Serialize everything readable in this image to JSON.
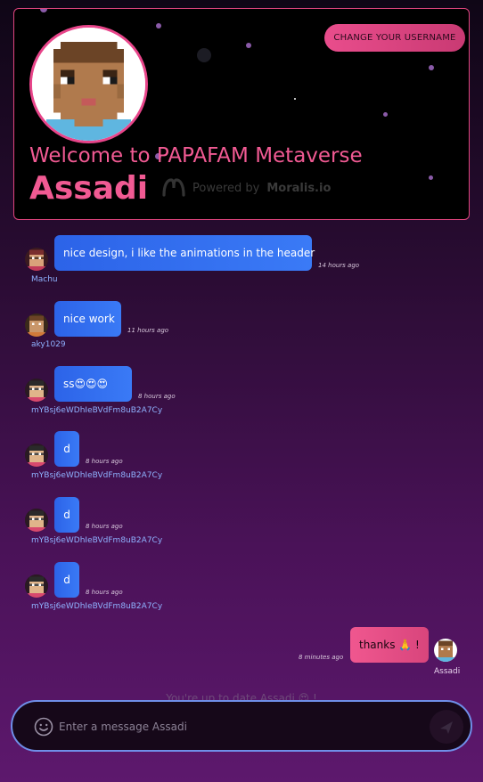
{
  "header": {
    "change_username_label": "CHANGE YOUR USERNAME",
    "welcome_text": "Welcome to PAPAFAM Metaverse",
    "username": "Assadi",
    "powered_prefix": "Powered by",
    "powered_brand": "Moralis.io"
  },
  "messages": [
    {
      "text": "nice design, i like the animations in the header",
      "time": "14 hours ago",
      "user": "Machu"
    },
    {
      "text": "nice work",
      "time": "11 hours ago",
      "user": "aky1029"
    },
    {
      "text": "ss😍😍😍",
      "time": "8 hours ago",
      "user": "mYBsj6eWDhIeBVdFm8uB2A7Cy"
    },
    {
      "text": "d",
      "time": "8 hours ago",
      "user": "mYBsj6eWDhIeBVdFm8uB2A7Cy"
    },
    {
      "text": "d",
      "time": "8 hours ago",
      "user": "mYBsj6eWDhIeBVdFm8uB2A7Cy"
    },
    {
      "text": "d",
      "time": "8 hours ago",
      "user": "mYBsj6eWDhIeBVdFm8uB2A7Cy"
    },
    {
      "text": "thanks 🙏 !",
      "time": "8 minutes ago",
      "user": "Assadi",
      "mine": true
    }
  ],
  "status": {
    "up_to_date": "You're up to date Assadi 😍 !"
  },
  "composer": {
    "placeholder": "Enter a message Assadi",
    "emoji_icon": "smiley-icon",
    "send_icon": "send-icon"
  },
  "colors": {
    "accent_pink": "#e94d8c",
    "bubble_blue": "#2c63e8",
    "input_border": "#6f8ee8"
  }
}
